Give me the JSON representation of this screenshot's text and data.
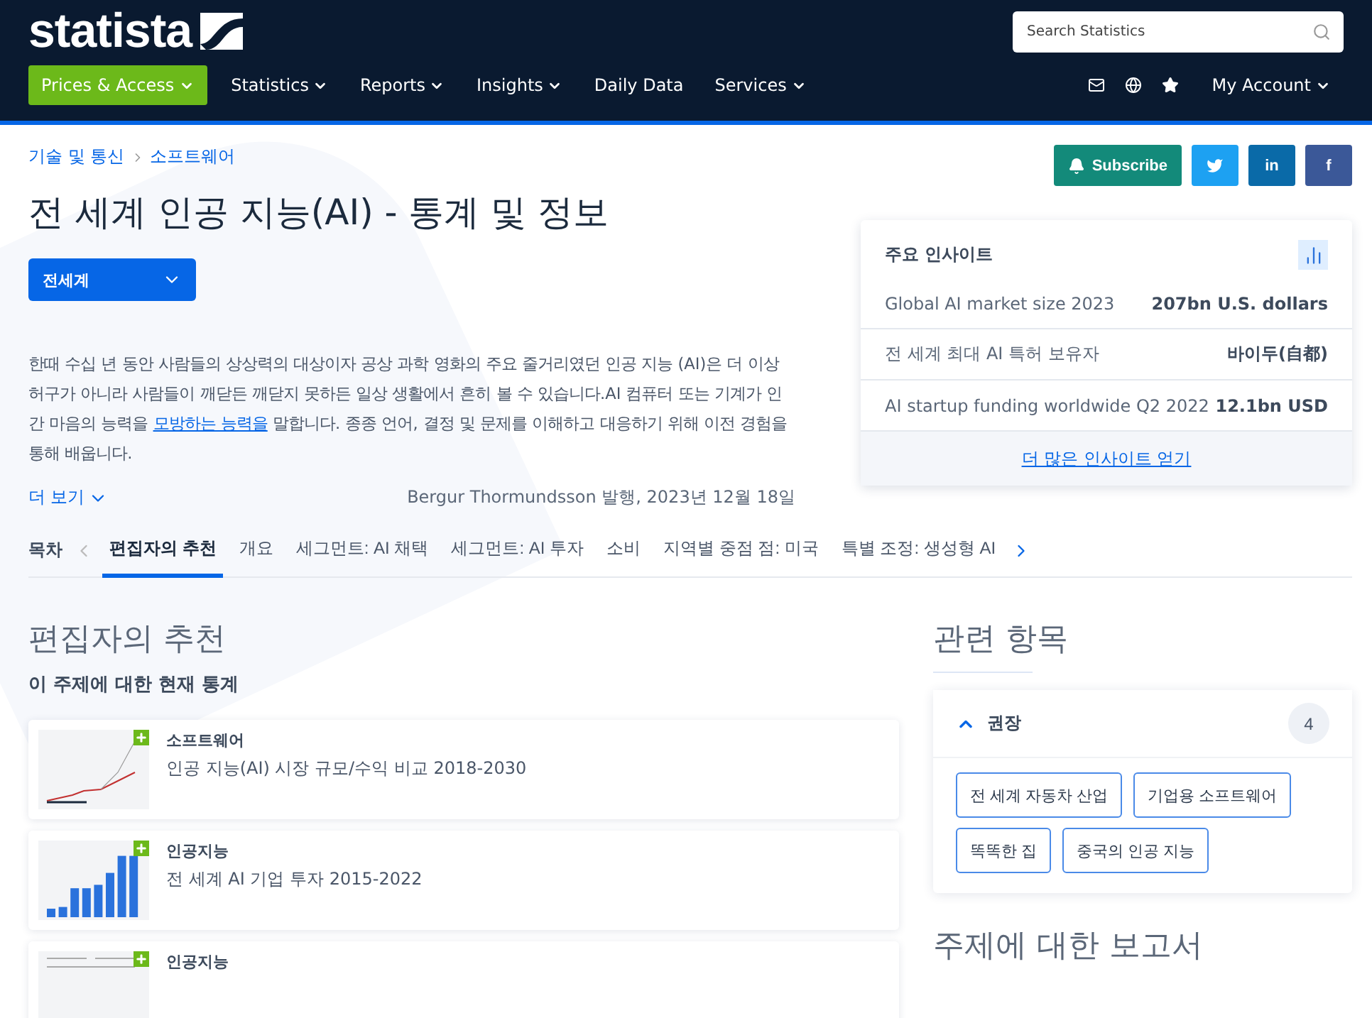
{
  "header": {
    "logo": "statista",
    "search": {
      "placeholder": "Search Statistics"
    },
    "nav": [
      {
        "label": "Prices & Access",
        "kind": "highlight",
        "dropdown": true
      },
      {
        "label": "Statistics",
        "kind": "plain",
        "dropdown": true
      },
      {
        "label": "Reports",
        "kind": "plain",
        "dropdown": true
      },
      {
        "label": "Insights",
        "kind": "plain",
        "dropdown": true
      },
      {
        "label": "Daily Data",
        "kind": "plain",
        "dropdown": false
      },
      {
        "label": "Services",
        "kind": "plain",
        "dropdown": true
      }
    ],
    "account": "My Account"
  },
  "breadcrumb": [
    "기술 및 통신",
    "소프트웨어"
  ],
  "title": "전 세계 인공 지능(AI) - 통계 및 정보",
  "region_select": "전세계",
  "description": {
    "before": "한때 수십 년 동안 사람들의 상상력의 대상이자 공상 과학 영화의 주요 줄거리였던 인공 지능 (AI)은 더 이상 허구가 아니라 사람들이 깨닫든 깨닫지 못하든 일상 생활에서 흔히 볼 수 있습니다.AI 컴퓨터 또는 기계가 인간 마음의 능력을 ",
    "link": "모방하는 능력을",
    "after": " 말합니다. 종종 언어, 결정 및 문제를 이해하고 대응하기 위해 이전 경험을 통해 배웁니다."
  },
  "more_link": "더 보기",
  "byline": "Bergur Thormundsson 발행, 2023년 12월 18일",
  "share": {
    "subscribe": "Subscribe",
    "linkedin": "in",
    "facebook": "f"
  },
  "insights": {
    "title": "주요 인사이트",
    "rows": [
      {
        "label": "Global AI market size 2023",
        "value": "207bn U.S. dollars"
      },
      {
        "label": "전 세계 최대 AI 특허 보유자",
        "value": "바이두(自都)"
      },
      {
        "label": "AI startup funding worldwide Q2 2022",
        "value": "12.1bn USD"
      }
    ],
    "footer_link": "더 많은 인사이트 얻기"
  },
  "toc": {
    "label": "목차",
    "tabs": [
      {
        "label": "편집자의 추천",
        "selected": true
      },
      {
        "label": "개요",
        "selected": false
      },
      {
        "label": "세그먼트: AI 채택",
        "selected": false
      },
      {
        "label": "세그먼트: AI 투자",
        "selected": false
      },
      {
        "label": "소비",
        "selected": false
      },
      {
        "label": "지역별 중점 점: 미국",
        "selected": false
      },
      {
        "label": "특별 조정: 생성형 AI",
        "selected": false
      }
    ]
  },
  "editors_picks": {
    "title": "편집자의 추천",
    "subtitle": "이 주제에 대한 현재 통계",
    "cards": [
      {
        "kind": "line",
        "category": "소프트웨어",
        "title": "인공 지능(AI) 시장 규모/수익 비교 2018-2030"
      },
      {
        "kind": "bar",
        "category": "인공지능",
        "title": "전 세계 AI 기업 투자 2015-2022"
      },
      {
        "kind": "table",
        "category": "인공지능"
      }
    ]
  },
  "related": {
    "title": "관련 항목",
    "group": {
      "label": "권장",
      "count": "4",
      "expanded": true,
      "tags": [
        "전 세계 자동차 산업",
        "기업용 소프트웨어",
        "똑똑한 집",
        "중국의 인공 지능"
      ]
    }
  },
  "reports_title": "주제에 대한 보고서"
}
